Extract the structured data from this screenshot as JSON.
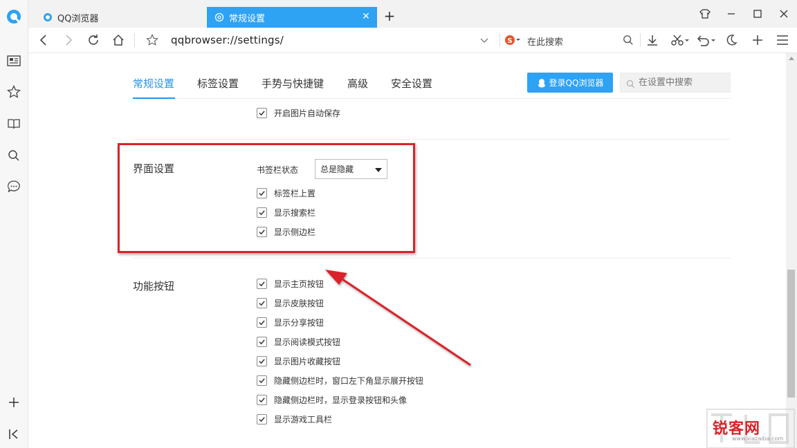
{
  "browser": {
    "tabs": [
      {
        "title": "QQ浏览器"
      },
      {
        "title": "常规设置",
        "active": true
      }
    ],
    "address": "qqbrowser://settings/",
    "search_engine_placeholder": "在此搜索"
  },
  "settings": {
    "nav_tabs": [
      "常规设置",
      "标签设置",
      "手势与快捷键",
      "高级",
      "安全设置"
    ],
    "active_tab": "常规设置",
    "login_button": "登录QQ浏览器",
    "search_placeholder": "在设置中搜索",
    "image_save": {
      "label": "开启图片自动保存",
      "checked": true
    },
    "interface": {
      "title": "界面设置",
      "bookmark_bar_label": "书签栏状态",
      "bookmark_bar_value": "总是隐藏",
      "options": [
        {
          "label": "标签栏上置",
          "checked": true
        },
        {
          "label": "显示搜索栏",
          "checked": true
        },
        {
          "label": "显示侧边栏",
          "checked": true
        }
      ]
    },
    "buttons": {
      "title": "功能按钮",
      "options": [
        {
          "label": "显示主页按钮",
          "checked": true
        },
        {
          "label": "显示皮肤按钮",
          "checked": true
        },
        {
          "label": "显示分享按钮",
          "checked": true
        },
        {
          "label": "显示阅读模式按钮",
          "checked": true
        },
        {
          "label": "显示图片收藏按钮",
          "checked": true
        },
        {
          "label": "隐藏侧边栏时，窗口左下角显示展开按钮",
          "checked": true
        },
        {
          "label": "隐藏侧边栏时，显示登录按钮和头像",
          "checked": true
        },
        {
          "label": "显示游戏工具栏",
          "checked": true
        }
      ]
    }
  },
  "watermark": {
    "text": "锐客网",
    "sub": "www.xiazaiba.com"
  },
  "colors": {
    "accent": "#2ea2f3",
    "annotation": "#d9232a"
  }
}
